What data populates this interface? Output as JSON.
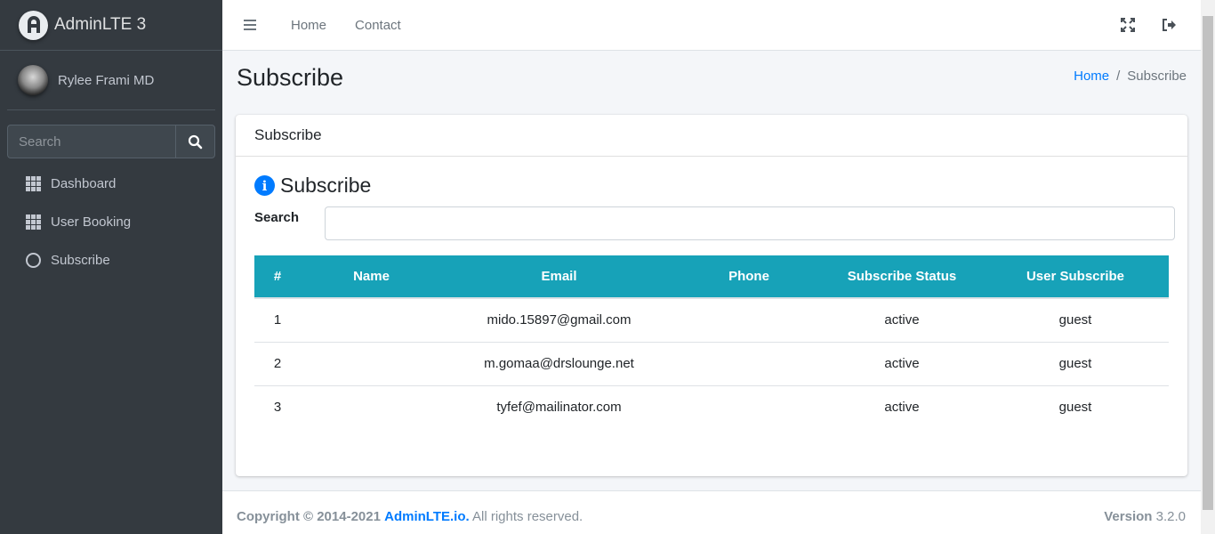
{
  "brand": {
    "name": "AdminLTE 3"
  },
  "user": {
    "name": "Rylee Frami MD"
  },
  "sidebar": {
    "search_placeholder": "Search",
    "items": [
      {
        "label": "Dashboard",
        "icon": "grid-icon"
      },
      {
        "label": "User Booking",
        "icon": "grid-icon"
      },
      {
        "label": "Subscribe",
        "icon": "circle-icon"
      }
    ]
  },
  "topnav": {
    "home": "Home",
    "contact": "Contact"
  },
  "page": {
    "title": "Subscribe"
  },
  "breadcrumb": {
    "home": "Home",
    "separator": "/",
    "current": "Subscribe"
  },
  "card": {
    "header": "Subscribe",
    "heading": "Subscribe",
    "search_label": "Search",
    "search_value": ""
  },
  "table": {
    "headers": [
      "#",
      "Name",
      "Email",
      "Phone",
      "Subscribe Status",
      "User Subscribe"
    ],
    "rows": [
      [
        "1",
        "",
        "mido.15897@gmail.com",
        "",
        "active",
        "guest"
      ],
      [
        "2",
        "",
        "m.gomaa@drslounge.net",
        "",
        "active",
        "guest"
      ],
      [
        "3",
        "",
        "tyfef@mailinator.com",
        "",
        "active",
        "guest"
      ]
    ]
  },
  "footer": {
    "copyright": "Copyright © 2014-2021",
    "link": "AdminLTE.io.",
    "rights": "All rights reserved.",
    "version_label": "Version",
    "version": "3.2.0"
  },
  "colors": {
    "sidebar": "#343a40",
    "accent": "#007bff",
    "table_header": "#17a2b8"
  }
}
